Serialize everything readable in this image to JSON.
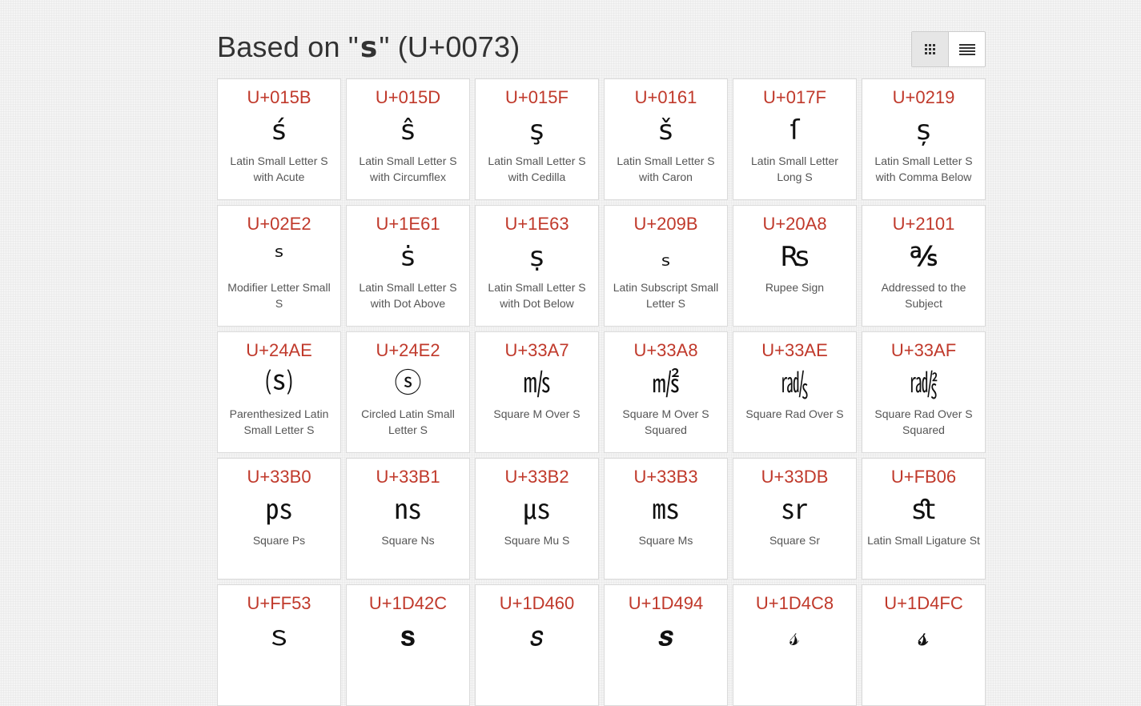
{
  "header": {
    "title_prefix": "Based on \"",
    "base_char": "s",
    "title_suffix": "\" (U+0073)"
  },
  "view_toggle": {
    "grid_icon": "grid-view-icon",
    "list_icon": "list-view-icon",
    "active": "grid"
  },
  "colors": {
    "code": "#c0392b",
    "card_border": "#dadada",
    "background": "#f4f4f4"
  },
  "cards": [
    {
      "code": "U+015B",
      "glyph": "ś",
      "name": "Latin Small Letter S with Acute"
    },
    {
      "code": "U+015D",
      "glyph": "ŝ",
      "name": "Latin Small Letter S with Circumflex"
    },
    {
      "code": "U+015F",
      "glyph": "ş",
      "name": "Latin Small Letter S with Cedilla"
    },
    {
      "code": "U+0161",
      "glyph": "š",
      "name": "Latin Small Letter S with Caron"
    },
    {
      "code": "U+017F",
      "glyph": "ſ",
      "name": "Latin Small Letter Long S"
    },
    {
      "code": "U+0219",
      "glyph": "ș",
      "name": "Latin Small Letter S with Comma Below"
    },
    {
      "code": "U+02E2",
      "glyph": "ˢ",
      "name": "Modifier Letter Small S"
    },
    {
      "code": "U+1E61",
      "glyph": "ṡ",
      "name": "Latin Small Letter S with Dot Above"
    },
    {
      "code": "U+1E63",
      "glyph": "ṣ",
      "name": "Latin Small Letter S with Dot Below"
    },
    {
      "code": "U+209B",
      "glyph": "ₛ",
      "name": "Latin Subscript Small Letter S"
    },
    {
      "code": "U+20A8",
      "glyph": "₨",
      "name": "Rupee Sign"
    },
    {
      "code": "U+2101",
      "glyph": "℁",
      "name": "Addressed to the Subject"
    },
    {
      "code": "U+24AE",
      "glyph": "⒮",
      "name": "Parenthesized Latin Small Letter S"
    },
    {
      "code": "U+24E2",
      "glyph": "ⓢ",
      "name": "Circled Latin Small Letter S"
    },
    {
      "code": "U+33A7",
      "glyph": "㎧",
      "name": "Square M Over S"
    },
    {
      "code": "U+33A8",
      "glyph": "㎨",
      "name": "Square M Over S Squared"
    },
    {
      "code": "U+33AE",
      "glyph": "㎮",
      "name": "Square Rad Over S"
    },
    {
      "code": "U+33AF",
      "glyph": "㎯",
      "name": "Square Rad Over S Squared"
    },
    {
      "code": "U+33B0",
      "glyph": "㎰",
      "name": "Square Ps"
    },
    {
      "code": "U+33B1",
      "glyph": "㎱",
      "name": "Square Ns"
    },
    {
      "code": "U+33B2",
      "glyph": "㎲",
      "name": "Square Mu S"
    },
    {
      "code": "U+33B3",
      "glyph": "㎳",
      "name": "Square Ms"
    },
    {
      "code": "U+33DB",
      "glyph": "㏛",
      "name": "Square Sr"
    },
    {
      "code": "U+FB06",
      "glyph": "ﬆ",
      "name": "Latin Small Ligature St"
    },
    {
      "code": "U+FF53",
      "glyph": "ｓ",
      "name": ""
    },
    {
      "code": "U+1D42C",
      "glyph": "𝐬",
      "name": ""
    },
    {
      "code": "U+1D460",
      "glyph": "𝑠",
      "name": ""
    },
    {
      "code": "U+1D494",
      "glyph": "𝒔",
      "name": ""
    },
    {
      "code": "U+1D4C8",
      "glyph": "𝓈",
      "name": ""
    },
    {
      "code": "U+1D4FC",
      "glyph": "𝓼",
      "name": ""
    }
  ]
}
